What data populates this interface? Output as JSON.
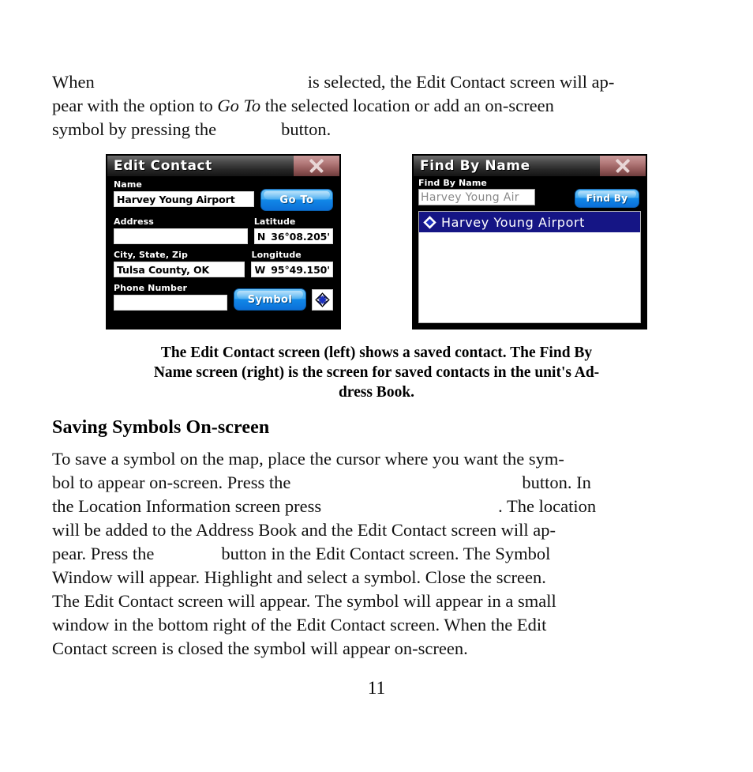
{
  "document": {
    "page_number": "11",
    "intro_paragraph": {
      "line1_a": "When",
      "line1_b": "is selected, the Edit Contact screen will ap-",
      "line2_a": "pear with the option to ",
      "line2_italic": "Go To",
      "line2_b": " the selected location or add an on-screen",
      "line3_a": "symbol by pressing the",
      "line3_b": "button."
    },
    "caption": {
      "line1": "The Edit Contact screen (left) shows a saved contact. The Find By",
      "line2": "Name screen (right) is the screen for saved contacts in the unit's Ad-",
      "line3": "dress Book."
    },
    "heading": "Saving Symbols On-screen",
    "body_paragraph": {
      "line1": "To save a symbol on the map, place the cursor where you want the sym-",
      "line2_a": "bol to appear on-screen. Press the",
      "line2_b": "button. In",
      "line3_a": "the Location Information screen press",
      "line3_b": ". The location",
      "line4": "will be added to the Address Book and the Edit Contact screen will ap-",
      "line5_a": "pear. Press the",
      "line5_b": "button in the Edit Contact screen. The Symbol",
      "line6": "Window will appear. Highlight and select a symbol. Close the screen.",
      "line7": "The Edit Contact screen will appear. The symbol will appear in a small",
      "line8": "window in the bottom right of the Edit Contact screen. When the Edit",
      "line9": "Contact screen is closed the symbol will appear on-screen."
    }
  },
  "edit_contact_screen": {
    "title": "Edit Contact",
    "close_icon": "close-x-icon",
    "fields": {
      "name_label": "Name",
      "name_value": "Harvey Young Airport",
      "address_label": "Address",
      "address_value": "",
      "city_label": "City, State, Zip",
      "city_value": "Tulsa County, OK",
      "phone_label": "Phone Number",
      "phone_value": "",
      "latitude_label": "Latitude",
      "latitude_hemisphere": "N",
      "latitude_value": "36°08.205'",
      "longitude_label": "Longitude",
      "longitude_hemisphere": "W",
      "longitude_value": "95°49.150'"
    },
    "buttons": {
      "goto_label": "Go To",
      "symbol_label": "Symbol"
    },
    "symbol_swatch_icon": "diamond-waypoint-icon"
  },
  "find_by_name_screen": {
    "title": "Find By Name",
    "close_icon": "close-x-icon",
    "search_label": "Find By Name",
    "search_value": "Harvey Young Air",
    "find_button_label": "Find By",
    "results": [
      {
        "icon": "diamond-waypoint-icon",
        "label": "Harvey Young Airport",
        "selected": true
      }
    ]
  },
  "colors": {
    "device_background": "#000000",
    "titlebar_gradient_top": "#6e6e6e",
    "titlebar_gradient_bottom": "#151515",
    "close_button": "#8d5353",
    "button_blue_light": "#6fc4f7",
    "button_blue_dark": "#0b6fd8",
    "selection_navy": "#151585",
    "field_white": "#ffffff",
    "search_text_gray": "#8a8a8a",
    "page_background": "#ffffff"
  }
}
